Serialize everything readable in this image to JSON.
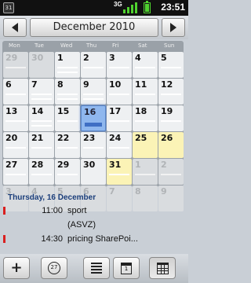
{
  "status_bar": {
    "notification_icon": "calendar-notification-icon",
    "notification_text": "31",
    "network_type": "3G",
    "signal_bars": 4,
    "battery_level": 0.8,
    "clock": "23:51"
  },
  "month_nav": {
    "title": "December 2010",
    "prev_icon": "arrow-left-icon",
    "next_icon": "arrow-right-icon"
  },
  "calendar": {
    "weekdays": [
      "Mon",
      "Tue",
      "Wed",
      "Thu",
      "Fri",
      "Sat",
      "Sun"
    ],
    "weeks": [
      [
        {
          "d": "29",
          "other": true,
          "ev": 1
        },
        {
          "d": "30",
          "other": true,
          "ev": 0
        },
        {
          "d": "1",
          "ev": 2
        },
        {
          "d": "2",
          "ev": 1
        },
        {
          "d": "3",
          "ev": 1
        },
        {
          "d": "4",
          "ev": 1
        },
        {
          "d": "5",
          "ev": 1
        }
      ],
      [
        {
          "d": "6",
          "ev": 1
        },
        {
          "d": "7",
          "ev": 2
        },
        {
          "d": "8",
          "ev": 2
        },
        {
          "d": "9",
          "ev": 2
        },
        {
          "d": "10",
          "ev": 1
        },
        {
          "d": "11",
          "ev": 1
        },
        {
          "d": "12",
          "ev": 1
        }
      ],
      [
        {
          "d": "13",
          "ev": 1
        },
        {
          "d": "14",
          "ev": 2
        },
        {
          "d": "15",
          "ev": 1
        },
        {
          "d": "16",
          "today": true,
          "ev": 1
        },
        {
          "d": "17",
          "ev": 1
        },
        {
          "d": "18",
          "ev": 1
        },
        {
          "d": "19",
          "ev": 1
        }
      ],
      [
        {
          "d": "20",
          "ev": 1
        },
        {
          "d": "21",
          "ev": 1
        },
        {
          "d": "22",
          "ev": 1
        },
        {
          "d": "23",
          "ev": 1
        },
        {
          "d": "24",
          "ev": 1
        },
        {
          "d": "25",
          "hl": true,
          "ev": 0
        },
        {
          "d": "26",
          "hl": true,
          "ev": 0
        }
      ],
      [
        {
          "d": "27",
          "ev": 1
        },
        {
          "d": "28",
          "ev": 1
        },
        {
          "d": "29",
          "ev": 1
        },
        {
          "d": "30",
          "ev": 0
        },
        {
          "d": "31",
          "hl": true,
          "ev": 1
        },
        {
          "d": "1",
          "other": true,
          "ev": 1
        },
        {
          "d": "2",
          "other": true,
          "ev": 1
        }
      ],
      [
        {
          "d": "3",
          "other": true,
          "ev": 0
        },
        {
          "d": "4",
          "other": true,
          "ev": 0
        },
        {
          "d": "5",
          "other": true,
          "ev": 0
        },
        {
          "d": "6",
          "other": true,
          "ev": 0
        },
        {
          "d": "7",
          "other": true,
          "ev": 0
        },
        {
          "d": "8",
          "other": true,
          "ev": 0
        },
        {
          "d": "9",
          "other": true,
          "ev": 0
        }
      ]
    ]
  },
  "agenda": {
    "date_label": "Thursday, 16 December",
    "items": [
      {
        "time": "11:00",
        "title": "sport",
        "marker": true
      },
      {
        "time": "",
        "title": "(ASVZ)",
        "marker": false
      },
      {
        "time": "14:30",
        "title": "pricing SharePoi...",
        "marker": true
      }
    ]
  },
  "toolbar": {
    "buttons": [
      {
        "name": "new-event-button",
        "icon": "plus-icon",
        "glyph": "+",
        "active": false
      },
      {
        "name": "go-to-date-button",
        "icon": "goto-date-icon",
        "glyph": "27",
        "active": false
      },
      {
        "name": "agenda-view-button",
        "icon": "list-icon",
        "glyph": "",
        "active": false
      },
      {
        "name": "day-view-button",
        "icon": "day-calendar-icon",
        "glyph": "1",
        "active": false
      },
      {
        "name": "month-view-button",
        "icon": "month-grid-icon",
        "glyph": "",
        "active": true
      }
    ]
  },
  "colors": {
    "weekend_highlight": "#fbf3b6",
    "today_highlight": "#8fb7ee",
    "agenda_date": "#1a3d7a",
    "agenda_marker": "#d92020",
    "signal_green": "#4fd12f"
  }
}
